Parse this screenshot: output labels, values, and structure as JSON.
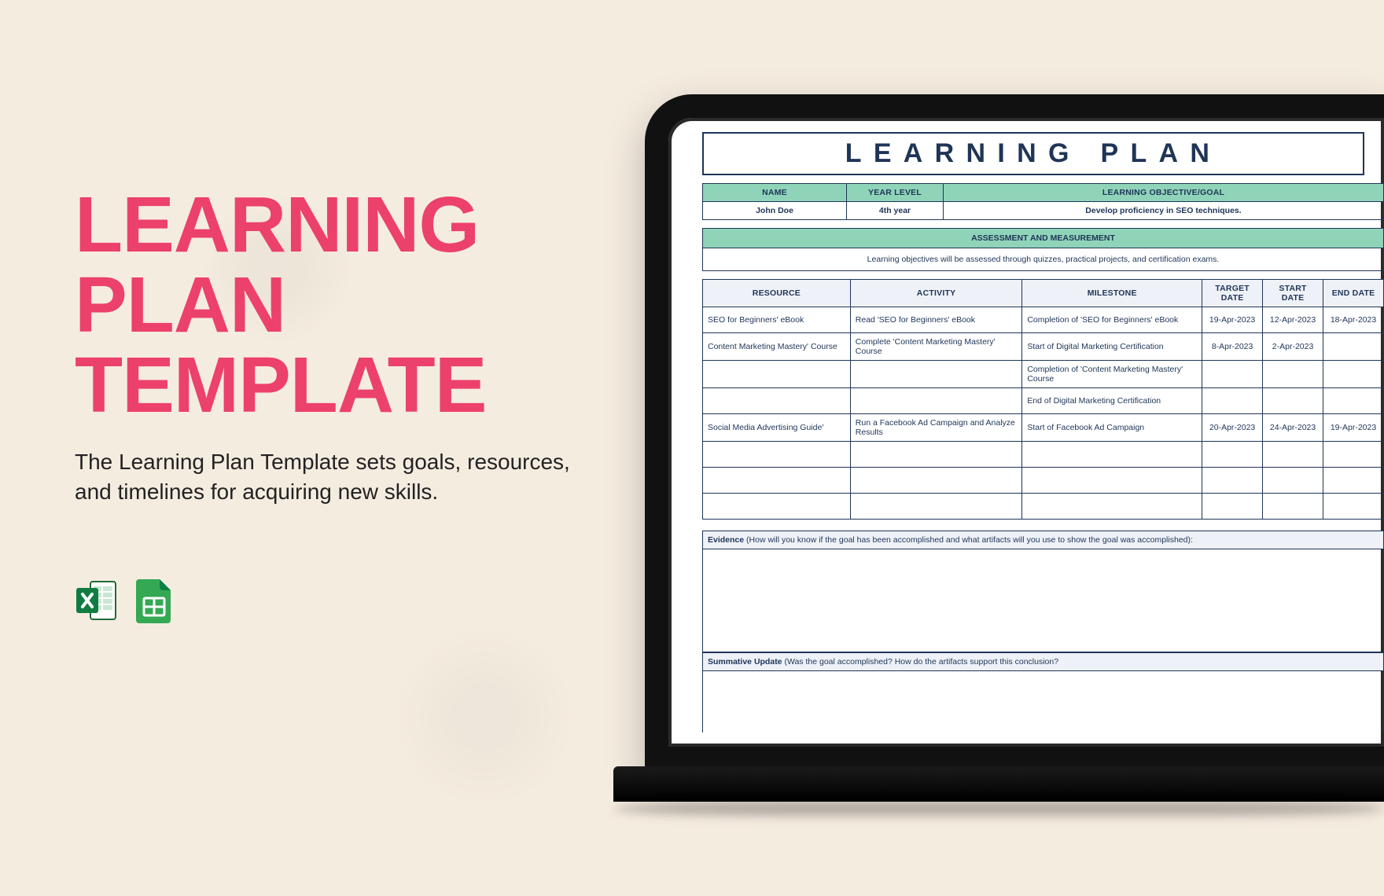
{
  "promo": {
    "title_l1": "LEARNING",
    "title_l2": "PLAN",
    "title_l3": "TEMPLATE",
    "description": "The Learning Plan Template sets goals, resources, and timelines for acquiring new skills."
  },
  "doc": {
    "title": "LEARNING PLAN",
    "header": {
      "name": "NAME",
      "year": "YEAR LEVEL",
      "objective": "LEARNING OBJECTIVE/GOAL"
    },
    "values": {
      "name": "John Doe",
      "year": "4th year",
      "objective": "Develop proficiency in SEO techniques."
    },
    "assessment": {
      "heading": "ASSESSMENT AND MEASUREMENT",
      "text": "Learning objectives will be assessed through quizzes, practical projects, and certification exams."
    },
    "grid": {
      "headers": [
        "RESOURCE",
        "ACTIVITY",
        "MILESTONE",
        "TARGET DATE",
        "START DATE",
        "END DATE"
      ],
      "rows": [
        [
          "SEO for Beginners' eBook",
          "Read 'SEO for Beginners' eBook",
          "Completion of 'SEO for Beginners' eBook",
          "19-Apr-2023",
          "12-Apr-2023",
          "18-Apr-2023"
        ],
        [
          "Content Marketing Mastery' Course",
          "Complete 'Content Marketing Mastery' Course",
          "Start of Digital Marketing Certification",
          "8-Apr-2023",
          "2-Apr-2023",
          ""
        ],
        [
          "",
          "",
          "Completion of 'Content Marketing Mastery' Course",
          "",
          "",
          ""
        ],
        [
          "",
          "",
          "End of Digital Marketing Certification",
          "",
          "",
          ""
        ],
        [
          "Social Media Advertising Guide'",
          "Run a Facebook Ad Campaign and Analyze Results",
          "Start of Facebook Ad Campaign",
          "20-Apr-2023",
          "24-Apr-2023",
          "19-Apr-2023"
        ]
      ]
    },
    "evidence": {
      "label": "Evidence ",
      "hint": "(How will you know if the goal has been accomplished and what artifacts will you use to show the goal was accomplished):"
    },
    "summative": {
      "label": "Summative Update ",
      "hint": "(Was the goal accomplished? How do the artifacts support this conclusion?"
    }
  }
}
